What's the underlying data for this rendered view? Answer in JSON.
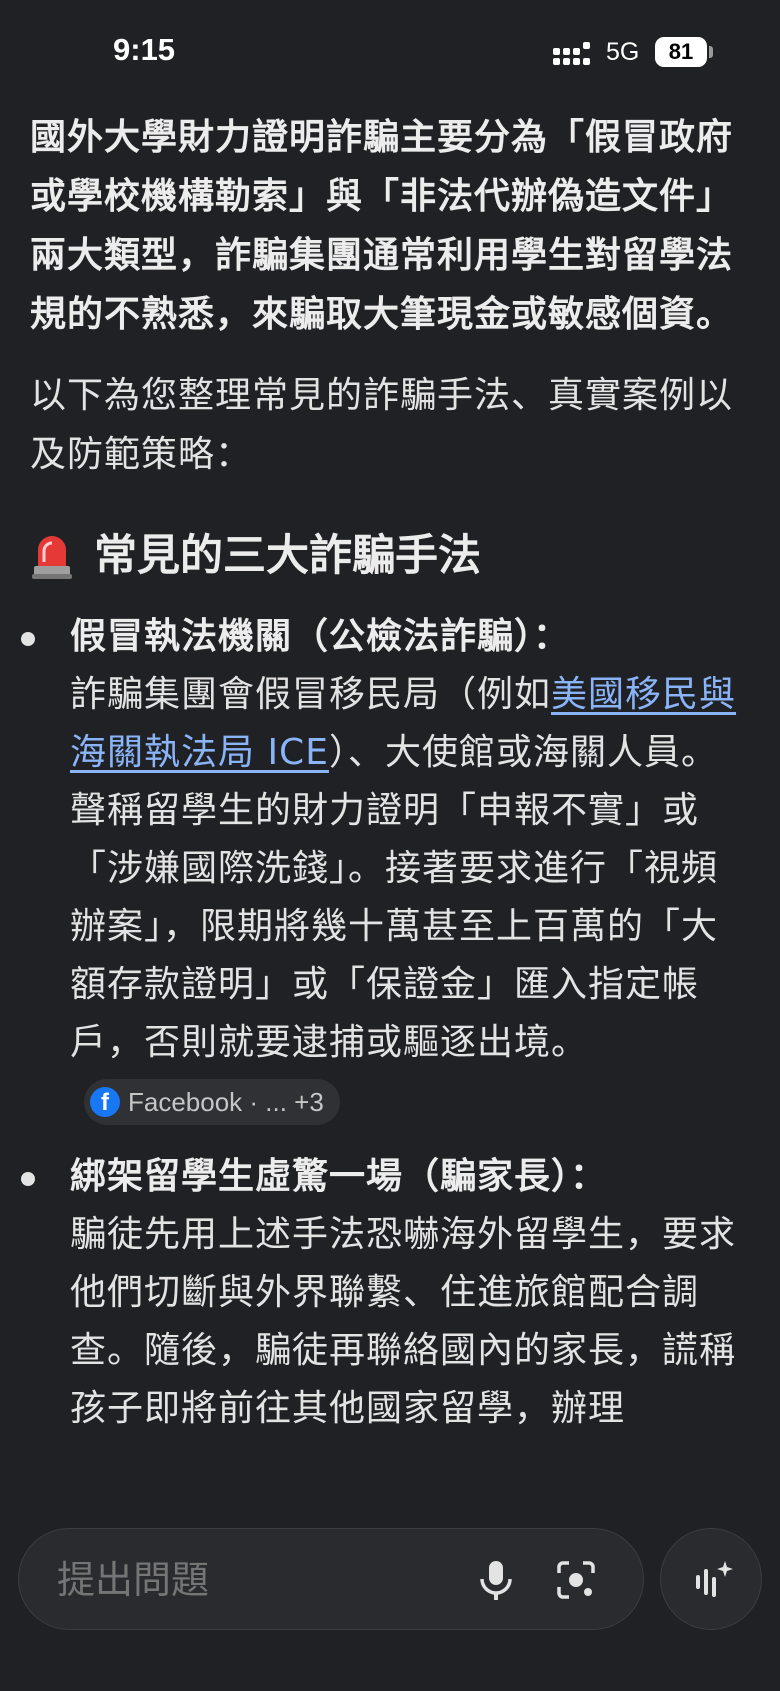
{
  "status_bar": {
    "time": "9:15",
    "network": "5G",
    "battery": "81"
  },
  "answer": {
    "intro_bold": "國外大學財力證明詐騙主要分為「假冒政府或學校機構勒索」與「非法代辦偽造文件」兩大類型，詐騙集團通常利用學生對留學法規的不熟悉，來騙取大筆現金或敏感個資。",
    "intro_plain": "以下為您整理常見的詐騙手法、真實案例以及防範策略：",
    "section_heading": "常見的三大詐騙手法",
    "bullets": [
      {
        "title": "假冒執法機關（公檢法詐騙）：",
        "body_pre": "詐騙集團會假冒移民局（例如",
        "link": "美國移民與海關執法局 ICE",
        "body_post": "）、大使館或海關人員。聲稱留學生的財力證明「申報不實」或「涉嫌國際洗錢」。接著要求進行「視頻辦案」，限期將幾十萬甚至上百萬的「大額存款證明」或「保證金」匯入指定帳戶，否則就要逮捕或驅逐出境。",
        "source": "Facebook · ... +3"
      },
      {
        "title": "綁架留學生虛驚一場（騙家長）：",
        "body": "騙徒先用上述手法恐嚇海外留學生，要求他們切斷與外界聯繫、住進旅館配合調查。隨後，騙徒再聯絡國內的家長，謊稱孩子即將前往其他國家留學，辦理"
      }
    ]
  },
  "prompt": {
    "placeholder": "提出問題"
  },
  "icons": {
    "siren": "siren-icon",
    "source": "facebook-icon",
    "mic": "mic-icon",
    "camera": "camera-search-icon",
    "live": "live-sparkle-icon"
  },
  "colors": {
    "background": "#202124",
    "link": "#8ab4f8",
    "facebook": "#1877f2"
  }
}
